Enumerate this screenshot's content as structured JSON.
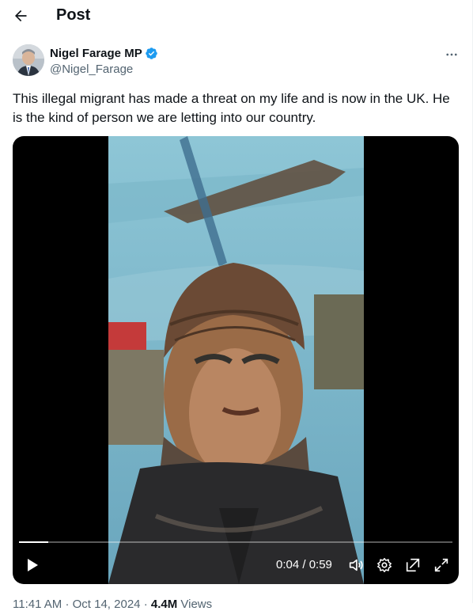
{
  "header": {
    "back_icon": "arrow-left-icon",
    "title": "Post"
  },
  "author": {
    "name": "Nigel Farage MP",
    "handle": "@Nigel_Farage",
    "verified": true,
    "verified_color": "#1d9bf0"
  },
  "post": {
    "text": "This illegal migrant has made a threat on my life and is now in the UK. He is the kind of person we are letting into our country."
  },
  "video": {
    "current_time": "0:04",
    "duration": "0:59",
    "time_display": "0:04 / 0:59",
    "progress": 0.068,
    "controls": [
      "play-icon",
      "volume-icon",
      "settings-icon",
      "pop-out-icon",
      "fullscreen-icon"
    ]
  },
  "meta": {
    "time": "11:41 AM",
    "separator": "·",
    "date": "Oct 14, 2024",
    "views_count": "4.4M",
    "views_label": "Views"
  }
}
